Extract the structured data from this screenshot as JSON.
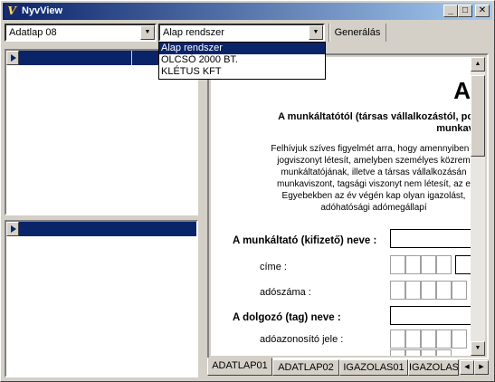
{
  "window": {
    "title": "NyvView",
    "app_icon": "nyvview-logo-icon"
  },
  "titlebar_buttons": {
    "minimize": "_",
    "maximize": "□",
    "close": "✕"
  },
  "toolbar": {
    "form_select": {
      "value": "Adatlap 08"
    },
    "system_select": {
      "value": "Alap rendszer",
      "options": [
        "Alap rendszer",
        "OLCSÓ 2000 BT.",
        "KLÉTUS KFT"
      ],
      "selected_index": 0
    },
    "generate_button": "Generálás"
  },
  "document": {
    "title": "A",
    "subtitle_lines": [
      "A munkáltatótól (társas vállalkozástól, polgá",
      "munkav"
    ],
    "paragraph_lines": [
      "Felhívjuk szíves figyelmét arra, hogy amennyiben a",
      "jogviszonyt létesít, amelyben személyes közrem",
      "munkáltatójának, illetve a társas vállalkozásán",
      "munkaviszont, tagsági viszonyt nem létesít, az e",
      "Egyebekben az év végén kap olyan igazolást,",
      "adóhatósági adómegállapí"
    ],
    "fields": {
      "employer_name": "A munkáltató (kifizető) neve :",
      "address": "címe :",
      "tax_number": "adószáma :",
      "employee_name": "A dolgozó (tag) neve :",
      "tax_id": "adóazonosító jele :"
    }
  },
  "tabs": [
    "ADATLAP01",
    "ADATLAP02",
    "IGAZOLAS01",
    "IGAZOLAS"
  ],
  "active_tab": 0,
  "colors": {
    "selection": "#0a246a",
    "face": "#d4d0c8"
  }
}
